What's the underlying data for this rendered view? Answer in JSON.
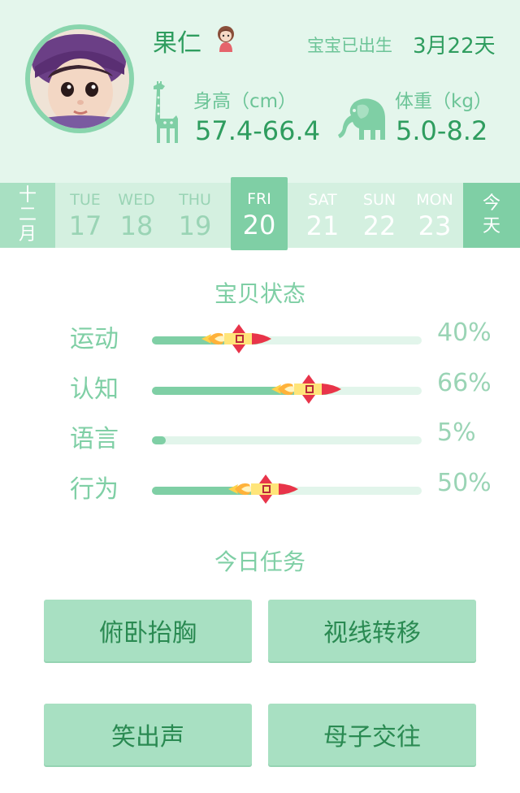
{
  "profile": {
    "name": "果仁",
    "born_label": "宝宝已出生",
    "born_value": "3月22天",
    "height_label": "身高（cm）",
    "height_value": "57.4-66.4",
    "weight_label": "体重（kg）",
    "weight_value": "5.0-8.2"
  },
  "calendar": {
    "month": "十二月",
    "today": "今天",
    "days": [
      {
        "dow": "TUE",
        "num": "17"
      },
      {
        "dow": "WED",
        "num": "18"
      },
      {
        "dow": "THU",
        "num": "19"
      },
      {
        "dow": "FRI",
        "num": "20"
      },
      {
        "dow": "SAT",
        "num": "21"
      },
      {
        "dow": "SUN",
        "num": "22"
      },
      {
        "dow": "MON",
        "num": "23"
      }
    ],
    "selected_index": 3
  },
  "status": {
    "title": "宝贝状态",
    "items": [
      {
        "label": "运动",
        "value": "40%",
        "progress": 0.4,
        "rocket": true
      },
      {
        "label": "认知",
        "value": "66%",
        "progress": 0.66,
        "rocket": true
      },
      {
        "label": "语言",
        "value": "5%",
        "progress": 0.05,
        "rocket": false
      },
      {
        "label": "行为",
        "value": "50%",
        "progress": 0.5,
        "rocket": true
      }
    ]
  },
  "tasks": {
    "title": "今日任务",
    "items": [
      "俯卧抬胸",
      "视线转移",
      "笑出声",
      "母子交往"
    ]
  },
  "colors": {
    "accent": "#7fcfa5",
    "header_bg": "#e4f6ec",
    "text_dark": "#2f9d5f",
    "task_bg": "#a8e0c2"
  },
  "icons": {
    "avatar": "baby-photo",
    "gender": "girl-icon",
    "height": "giraffe-icon",
    "weight": "elephant-icon",
    "progress_marker": "rocket-icon"
  }
}
